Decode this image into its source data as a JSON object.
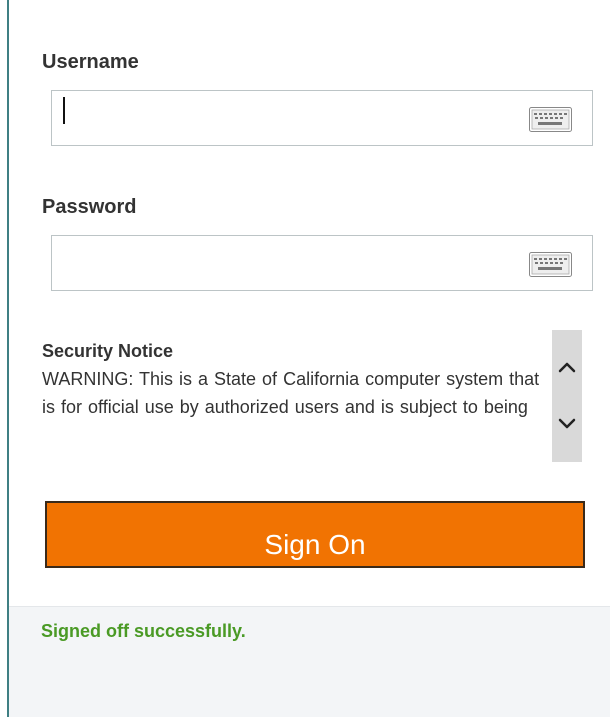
{
  "login": {
    "username_label": "Username",
    "username_value": "",
    "password_label": "Password",
    "password_value": "",
    "keyboard_icon": "virtual-keyboard-icon"
  },
  "notice": {
    "title": "Security Notice",
    "body": "WARNING: This is a State of California computer system that is for official use by authorized users and is subject to being",
    "scroll_up_icon": "chevron-up-icon",
    "scroll_down_icon": "chevron-down-icon"
  },
  "actions": {
    "sign_on_label": "Sign On"
  },
  "status": {
    "message": "Signed off successfully."
  },
  "colors": {
    "button": "#f17302",
    "status_text": "#4a9a25",
    "left_border": "#3f7f83"
  }
}
